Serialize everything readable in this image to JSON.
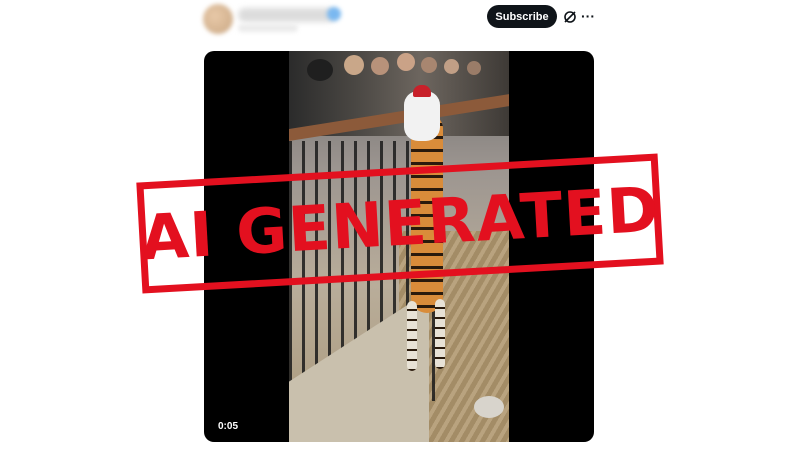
{
  "header": {
    "subscribe_label": "Subscribe",
    "grok_icon": "grok-icon",
    "more_icon": "more-icon",
    "more_glyph": "···"
  },
  "video": {
    "timestamp": "0:05"
  },
  "overlay": {
    "stamp_text": "AI GENERATED",
    "color": "#e3101f"
  },
  "colors": {
    "subscribe_bg": "#0f1419",
    "media_bg": "#000000"
  }
}
